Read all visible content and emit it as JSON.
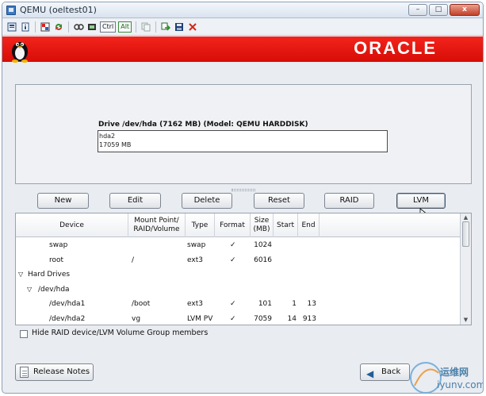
{
  "window": {
    "title": "QEMU (oeltest01)",
    "minimize": "–",
    "maximize": "□",
    "close": "x"
  },
  "toolbar": {
    "ctrl_label": "Ctrl",
    "alt_label": "Alt",
    "icons": [
      "settings-icon",
      "info-icon",
      "fullscreen-icon",
      "refresh-icon",
      "keyboard-icon",
      "grab-icon",
      "copy-icon",
      "paste-icon",
      "save-icon",
      "close-icon"
    ]
  },
  "banner": {
    "logo_text": "ORACLE",
    "accent_color": "#e8120b"
  },
  "drive": {
    "label": "Drive /dev/hda (7162 MB) (Model: QEMU HARDDISK)",
    "segment_name": "hda2",
    "segment_size": "17059 MB"
  },
  "actions": {
    "new": "New",
    "edit": "Edit",
    "delete": "Delete",
    "reset": "Reset",
    "raid": "RAID",
    "lvm": "LVM"
  },
  "table": {
    "headers": {
      "device": "Device",
      "mount": "Mount Point/\nRAID/Volume",
      "type": "Type",
      "format": "Format",
      "size": "Size\n(MB)",
      "start": "Start",
      "end": "End"
    },
    "rows": [
      {
        "device": "swap",
        "mount": "",
        "type": "swap",
        "format": "✓",
        "size": "1024",
        "start": "",
        "end": "",
        "indent": 2
      },
      {
        "device": "root",
        "mount": "/",
        "type": "ext3",
        "format": "✓",
        "size": "6016",
        "start": "",
        "end": "",
        "indent": 2
      },
      {
        "device": "Hard Drives",
        "mount": "",
        "type": "",
        "format": "",
        "size": "",
        "start": "",
        "end": "",
        "indent": 0,
        "expander": "▽"
      },
      {
        "device": "/dev/hda",
        "mount": "",
        "type": "",
        "format": "",
        "size": "",
        "start": "",
        "end": "",
        "indent": 1,
        "expander": "▽"
      },
      {
        "device": "/dev/hda1",
        "mount": "/boot",
        "type": "ext3",
        "format": "✓",
        "size": "101",
        "start": "1",
        "end": "13",
        "indent": 2
      },
      {
        "device": "/dev/hda2",
        "mount": "vg",
        "type": "LVM PV",
        "format": "✓",
        "size": "7059",
        "start": "14",
        "end": "913",
        "indent": 2
      }
    ]
  },
  "hide_raid": {
    "label": "Hide RAID device/LVM Volume Group members",
    "checked": false
  },
  "bottom": {
    "release_notes": "Release Notes",
    "back": "Back"
  },
  "watermark": {
    "text": "运维网",
    "url": "iyunv.com"
  }
}
